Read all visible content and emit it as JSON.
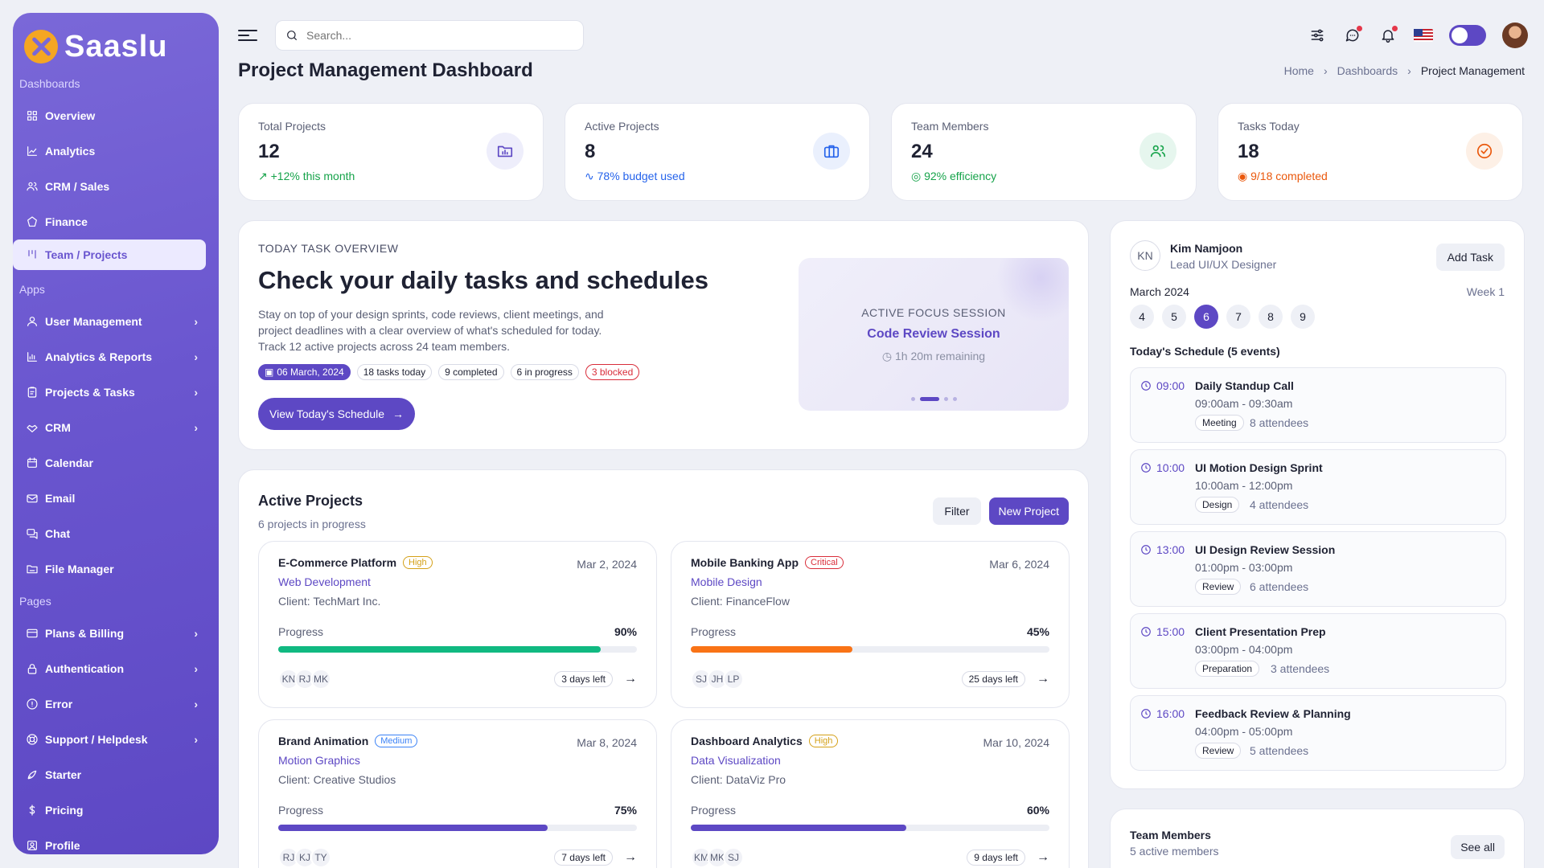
{
  "app": {
    "name": "Saaslu"
  },
  "sidebar": {
    "sections": [
      {
        "title": "Dashboards",
        "items": [
          {
            "label": "Overview",
            "icon": "grid-icon"
          },
          {
            "label": "Analytics",
            "icon": "chart-line-icon"
          },
          {
            "label": "CRM / Sales",
            "icon": "users-icon"
          },
          {
            "label": "Finance",
            "icon": "coin-icon"
          },
          {
            "label": "Team / Projects",
            "icon": "kanban-icon",
            "active": true
          }
        ]
      },
      {
        "title": "Apps",
        "items": [
          {
            "label": "User Management",
            "icon": "user-icon",
            "chevron": true
          },
          {
            "label": "Analytics & Reports",
            "icon": "bar-chart-icon",
            "chevron": true
          },
          {
            "label": "Projects & Tasks",
            "icon": "clipboard-icon",
            "chevron": true
          },
          {
            "label": "CRM",
            "icon": "handshake-icon",
            "chevron": true
          },
          {
            "label": "Calendar",
            "icon": "calendar-icon"
          },
          {
            "label": "Email",
            "icon": "mail-icon"
          },
          {
            "label": "Chat",
            "icon": "chat-icon"
          },
          {
            "label": "File Manager",
            "icon": "folder-icon"
          }
        ]
      },
      {
        "title": "Pages",
        "items": [
          {
            "label": "Plans & Billing",
            "icon": "credit-card-icon",
            "chevron": true
          },
          {
            "label": "Authentication",
            "icon": "lock-icon",
            "chevron": true
          },
          {
            "label": "Error",
            "icon": "alert-circle-icon",
            "chevron": true
          },
          {
            "label": "Support / Helpdesk",
            "icon": "lifebuoy-icon",
            "chevron": true
          },
          {
            "label": "Starter",
            "icon": "rocket-icon"
          },
          {
            "label": "Pricing",
            "icon": "dollar-icon"
          },
          {
            "label": "Profile",
            "icon": "profile-icon"
          }
        ]
      }
    ]
  },
  "topbar": {
    "search_placeholder": "Search..."
  },
  "header": {
    "title": "Project Management Dashboard",
    "breadcrumb": [
      "Home",
      "Dashboards",
      "Project Management"
    ]
  },
  "stats": [
    {
      "label": "Total Projects",
      "value": "12",
      "sub": "+12% this month",
      "color": "#16a34a",
      "icon": "folder-chart-icon"
    },
    {
      "label": "Active Projects",
      "value": "8",
      "sub": "78% budget used",
      "color": "#2563eb",
      "icon": "briefcase-icon"
    },
    {
      "label": "Team Members",
      "value": "24",
      "sub": "92% efficiency",
      "color": "#16a34a",
      "icon": "team-icon"
    },
    {
      "label": "Tasks Today",
      "value": "18",
      "sub": "9/18 completed",
      "color": "#ea580c",
      "icon": "check-circle-icon"
    }
  ],
  "overview": {
    "eyebrow": "TODAY TASK OVERVIEW",
    "title": "Check your daily tasks and schedules",
    "description": "Stay on top of your design sprints, code reviews, client meetings, and project deadlines with a clear overview of what's scheduled for today. Track 12 active projects across 24 team members.",
    "chips": [
      "06 March, 2024",
      "18 tasks today",
      "9 completed",
      "6 in progress",
      "3 blocked"
    ],
    "button": "View Today's Schedule",
    "focus": {
      "label": "ACTIVE FOCUS SESSION",
      "title": "Code Review Session",
      "remaining": "1h 20m remaining"
    }
  },
  "projects": {
    "title": "Active Projects",
    "subtitle": "6 projects in progress",
    "filter": "Filter",
    "new": "New Project",
    "progress_label": "Progress",
    "items": [
      {
        "name": "E-Commerce Platform",
        "priority": "High",
        "priority_color": "#d4a017",
        "date": "Mar 2, 2024",
        "category": "Web Development",
        "client": "Client: TechMart Inc.",
        "progress": 90,
        "pct": "90%",
        "bar_color": "#10b981",
        "avatars": [
          "KN",
          "RJ",
          "MK"
        ],
        "days": "3 days left"
      },
      {
        "name": "Mobile Banking App",
        "priority": "Critical",
        "priority_color": "#d92d3a",
        "date": "Mar 6, 2024",
        "category": "Mobile Design",
        "client": "Client: FinanceFlow",
        "progress": 45,
        "pct": "45%",
        "bar_color": "#f97316",
        "avatars": [
          "SJ",
          "JH",
          "LP"
        ],
        "days": "25 days left"
      },
      {
        "name": "Brand Animation",
        "priority": "Medium",
        "priority_color": "#3b82f6",
        "date": "Mar 8, 2024",
        "category": "Motion Graphics",
        "client": "Client: Creative Studios",
        "progress": 75,
        "pct": "75%",
        "bar_color": "#5d48c4",
        "avatars": [
          "RJ",
          "KJ",
          "TY"
        ],
        "days": "7 days left"
      },
      {
        "name": "Dashboard Analytics",
        "priority": "High",
        "priority_color": "#d4a017",
        "date": "Mar 10, 2024",
        "category": "Data Visualization",
        "client": "Client: DataViz Pro",
        "progress": 60,
        "pct": "60%",
        "bar_color": "#5d48c4",
        "avatars": [
          "KM",
          "MK",
          "SJ"
        ],
        "days": "9 days left"
      }
    ]
  },
  "schedule": {
    "initials": "KN",
    "user": "Kim Namjoon",
    "role": "Lead UI/UX Designer",
    "add_task": "Add Task",
    "month": "March 2024",
    "week": "Week 1",
    "days": [
      "4",
      "5",
      "6",
      "7",
      "8",
      "9"
    ],
    "selected_day": "6",
    "title": "Today's Schedule (5 events)",
    "events": [
      {
        "time": "09:00",
        "title": "Daily Standup Call",
        "range": "09:00am - 09:30am",
        "tag": "Meeting",
        "attendees": "8 attendees"
      },
      {
        "time": "10:00",
        "title": "UI Motion Design Sprint",
        "range": "10:00am - 12:00pm",
        "tag": "Design",
        "attendees": "4 attendees"
      },
      {
        "time": "13:00",
        "title": "UI Design Review Session",
        "range": "01:00pm - 03:00pm",
        "tag": "Review",
        "attendees": "6 attendees"
      },
      {
        "time": "15:00",
        "title": "Client Presentation Prep",
        "range": "03:00pm - 04:00pm",
        "tag": "Preparation",
        "attendees": "3 attendees"
      },
      {
        "time": "16:00",
        "title": "Feedback Review & Planning",
        "range": "04:00pm - 05:00pm",
        "tag": "Review",
        "attendees": "5 attendees"
      }
    ]
  },
  "team": {
    "title": "Team Members",
    "subtitle": "5 active members",
    "see_all": "See all"
  }
}
